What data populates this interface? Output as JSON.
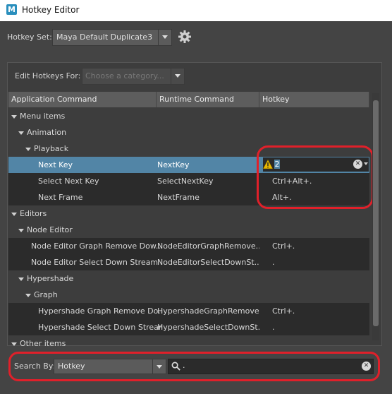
{
  "window": {
    "title": "Hotkey Editor",
    "app_icon": "M"
  },
  "hotkey_set": {
    "label": "Hotkey Set:",
    "value": "Maya Default Duplicate3"
  },
  "edit_for": {
    "label": "Edit Hotkeys For:",
    "placeholder": "Choose a category..."
  },
  "columns": [
    "Application Command",
    "Runtime Command",
    "Hotkey"
  ],
  "rows": [
    {
      "indent": 0,
      "group": true,
      "app": "Menu items",
      "runtime": "",
      "hotkey": ""
    },
    {
      "indent": 1,
      "group": true,
      "app": "Animation",
      "runtime": "",
      "hotkey": ""
    },
    {
      "indent": 2,
      "group": true,
      "app": "Playback",
      "runtime": "",
      "hotkey": ""
    },
    {
      "indent": 3,
      "group": false,
      "app": "Next Key",
      "runtime": "NextKey",
      "hotkey": "",
      "selected": true
    },
    {
      "indent": 3,
      "group": false,
      "app": "Select Next Key",
      "runtime": "SelectNextKey",
      "hotkey": "Ctrl+Alt+."
    },
    {
      "indent": 3,
      "group": false,
      "app": "Next Frame",
      "runtime": "NextFrame",
      "hotkey": "Alt+."
    },
    {
      "indent": 0,
      "group": true,
      "app": "Editors",
      "runtime": "",
      "hotkey": ""
    },
    {
      "indent": 1,
      "group": true,
      "app": "Node Editor",
      "runtime": "",
      "hotkey": ""
    },
    {
      "indent": 2,
      "group": false,
      "app": "Node Editor Graph Remove Dow...",
      "runtime": "NodeEditorGraphRemove...",
      "hotkey": "Ctrl+."
    },
    {
      "indent": 2,
      "group": false,
      "app": "Node Editor Select Down Stream",
      "runtime": "NodeEditorSelectDownSt...",
      "hotkey": "."
    },
    {
      "indent": 1,
      "group": true,
      "app": "Hypershade",
      "runtime": "",
      "hotkey": ""
    },
    {
      "indent": 2,
      "group": true,
      "app": "Graph",
      "runtime": "",
      "hotkey": ""
    },
    {
      "indent": 3,
      "group": false,
      "app": "Hypershade Graph Remove Do...",
      "runtime": "HypershadeGraphRemove...",
      "hotkey": "Ctrl+."
    },
    {
      "indent": 3,
      "group": false,
      "app": "Hypershade Select Down Stream",
      "runtime": "HypershadeSelectDownSt...",
      "hotkey": "."
    },
    {
      "indent": 0,
      "group": true,
      "app": "Other items",
      "runtime": "",
      "hotkey": ""
    }
  ],
  "hotkey_editor": {
    "value": "2"
  },
  "search": {
    "label": "Search By:",
    "mode": "Hotkey",
    "query": "."
  },
  "colors": {
    "accent": "#5285a6",
    "highlight": "#e0202a"
  }
}
